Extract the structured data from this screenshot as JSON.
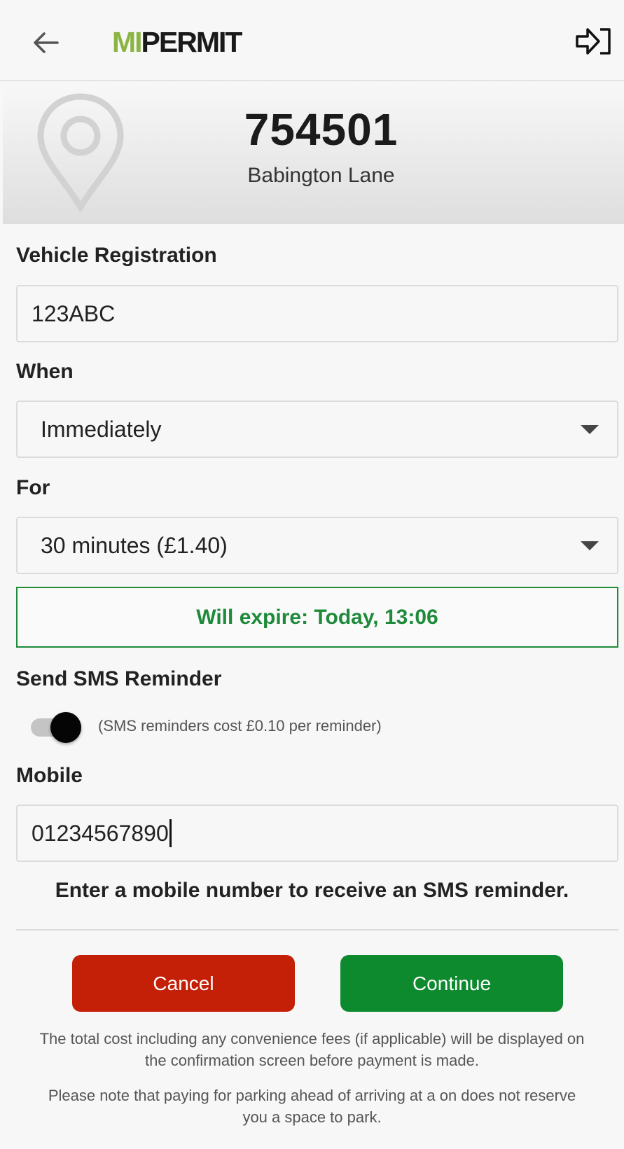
{
  "header": {
    "logo_mi": "MI",
    "logo_permit": "PERMIT"
  },
  "location": {
    "code": "754501",
    "name": "Babington Lane"
  },
  "form": {
    "vehicle_label": "Vehicle Registration",
    "vehicle_value": "123ABC",
    "when_label": "When",
    "when_value": "Immediately",
    "for_label": "For",
    "for_value": "30 minutes (£1.40)",
    "expire_text": "Will expire: Today, 13:06",
    "sms_label": "Send SMS Reminder",
    "sms_enabled": true,
    "sms_note": "(SMS reminders cost £0.10 per reminder)",
    "mobile_label": "Mobile",
    "mobile_value": "01234567890",
    "mobile_hint": "Enter a mobile number to receive an SMS reminder."
  },
  "actions": {
    "cancel_label": "Cancel",
    "continue_label": "Continue"
  },
  "notes": {
    "line1": "The total cost including any convenience fees (if applicable) will be displayed on",
    "line2": "the confirmation screen before payment is made.",
    "line3": "Please note that paying for parking ahead of arriving at a on does not reserve",
    "line4": "you a space to park."
  },
  "colors": {
    "brand_green": "#8bb543",
    "success_green": "#1e8a3a",
    "cancel_red": "#c42008",
    "continue_green": "#0e8a2e"
  },
  "icons": {
    "back": "arrow-left-icon",
    "logout": "logout-icon",
    "location": "map-pin-icon",
    "dropdown": "caret-down-icon"
  }
}
